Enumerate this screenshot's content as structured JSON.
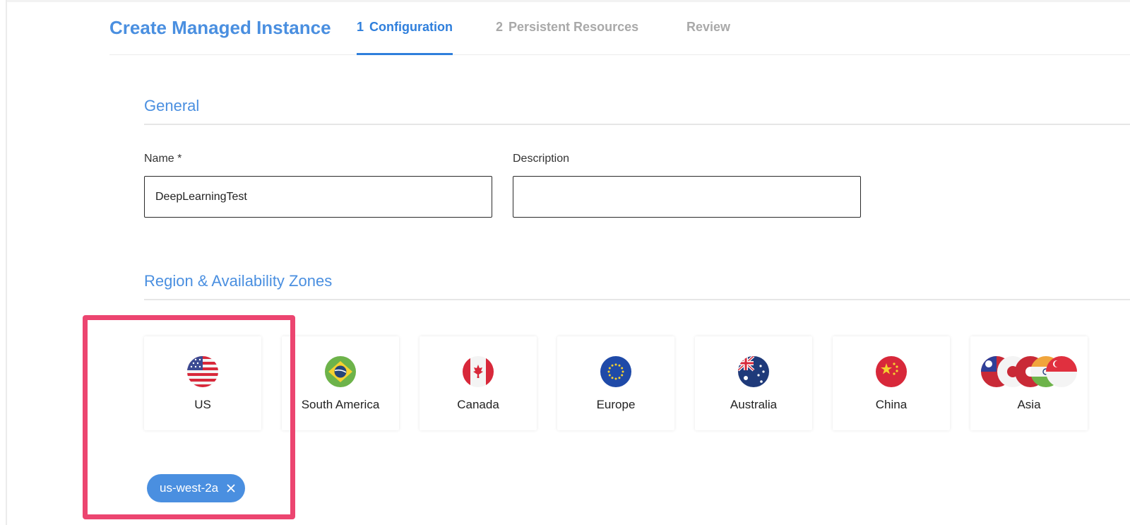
{
  "header": {
    "title": "Create Managed Instance",
    "tabs": [
      {
        "num": "1",
        "label": "Configuration"
      },
      {
        "num": "2",
        "label": "Persistent Resources"
      },
      {
        "num": "",
        "label": "Review"
      }
    ]
  },
  "general": {
    "title": "General",
    "name_label": "Name *",
    "name_value": "DeepLearningTest",
    "description_label": "Description",
    "description_value": ""
  },
  "regions": {
    "title": "Region & Availability Zones",
    "items": [
      {
        "label": "US"
      },
      {
        "label": "South America"
      },
      {
        "label": "Canada"
      },
      {
        "label": "Europe"
      },
      {
        "label": "Australia"
      },
      {
        "label": "China"
      },
      {
        "label": "Asia"
      }
    ],
    "selected_zone": "us-west-2a"
  },
  "colors": {
    "accent": "#4a8fe0",
    "highlight": "#ec4570"
  },
  "icons": {
    "flags": [
      "us-flag-icon",
      "brazil-flag-icon",
      "canada-flag-icon",
      "eu-flag-icon",
      "australia-flag-icon",
      "china-flag-icon",
      "asia-flags-icon"
    ],
    "chip_close": "close-icon"
  }
}
